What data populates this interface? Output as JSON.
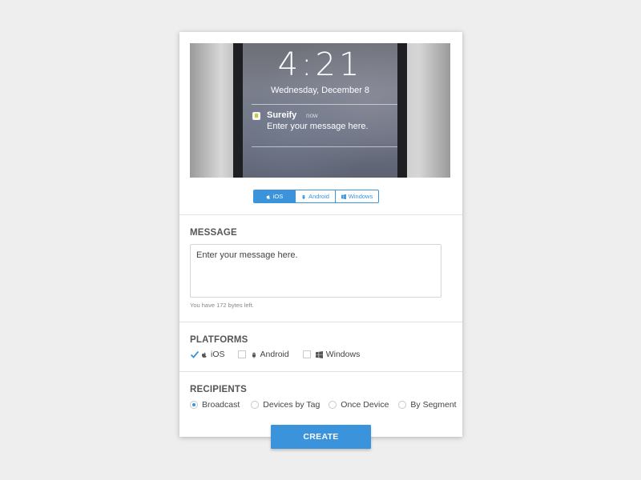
{
  "preview": {
    "time": "4:21",
    "date": "Wednesday, December 8",
    "app_name": "Sureify",
    "notif_time": "now",
    "message": "Enter your message here."
  },
  "platform_tabs": {
    "active": "iOS",
    "items": [
      {
        "label": "iOS",
        "icon": "apple-icon"
      },
      {
        "label": "Android",
        "icon": "android-icon"
      },
      {
        "label": "Windows",
        "icon": "windows-icon"
      }
    ]
  },
  "message_section": {
    "title": "MESSAGE",
    "value": "Enter your message here.",
    "bytes_left": "You have 172 bytes left."
  },
  "platforms_section": {
    "title": "PLATFORMS",
    "options": [
      {
        "label": "iOS",
        "checked": true,
        "icon": "apple-icon"
      },
      {
        "label": "Android",
        "checked": false,
        "icon": "android-icon"
      },
      {
        "label": "Windows",
        "checked": false,
        "icon": "windows-icon"
      }
    ]
  },
  "recipients_section": {
    "title": "RECIPIENTS",
    "options": [
      {
        "label": "Broadcast",
        "selected": true
      },
      {
        "label": "Devices by Tag",
        "selected": false
      },
      {
        "label": "Once Device",
        "selected": false
      },
      {
        "label": "By Segment",
        "selected": false
      }
    ]
  },
  "create_button": "CREATE",
  "colors": {
    "accent": "#3a93db",
    "background": "#eeeeee",
    "card": "#ffffff"
  }
}
